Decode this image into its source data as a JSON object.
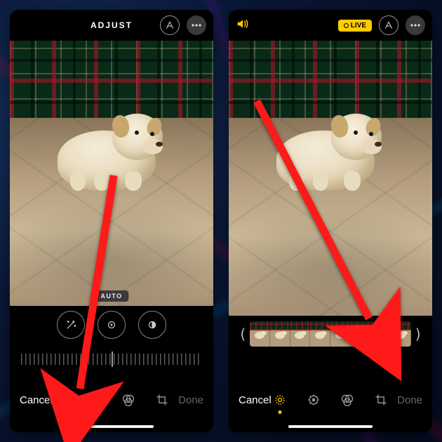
{
  "left_phone": {
    "topbar": {
      "title": "ADJUST"
    },
    "auto_badge": "AUTO",
    "slider_value": 0,
    "bottom": {
      "cancel": "Cancel",
      "done": "Done"
    },
    "modes": [
      "live",
      "adjust",
      "filters",
      "crop"
    ],
    "active_mode_index": 1
  },
  "right_phone": {
    "topbar": {
      "live_label": "LIVE"
    },
    "frames": {
      "count": 8,
      "selected_index": 6
    },
    "bottom": {
      "cancel": "Cancel",
      "done": "Done"
    },
    "modes": [
      "live",
      "adjust",
      "filters",
      "crop"
    ],
    "active_mode_index": 0
  },
  "colors": {
    "accent_yellow": "#ffcc00",
    "arrow_red": "#ff1a1a"
  }
}
